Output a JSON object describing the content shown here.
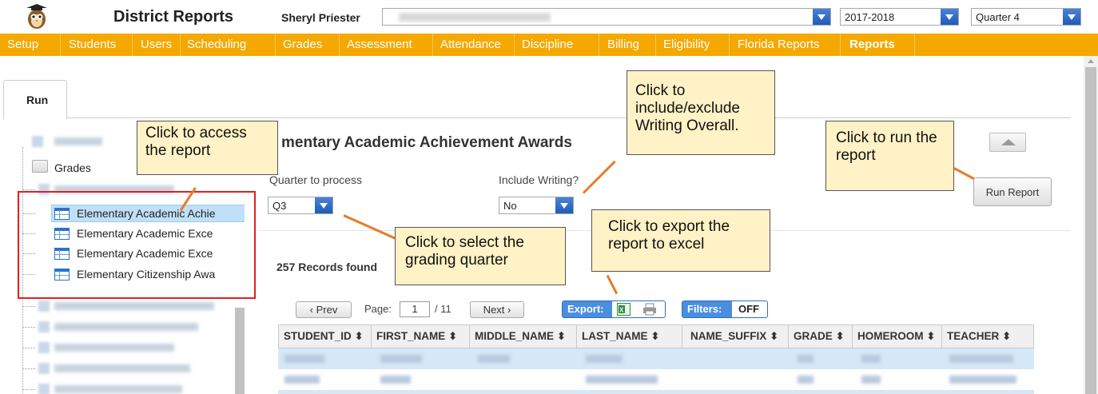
{
  "header": {
    "app_title": "District Reports",
    "user_name": "Sheryl Priester",
    "school_select": {
      "value": ""
    },
    "year_select": {
      "value": "2017-2018"
    },
    "quarter_select": {
      "value": "Quarter 4"
    }
  },
  "nav": {
    "items": [
      "Setup",
      "Students",
      "Users",
      "Scheduling",
      "Grades",
      "Assessment",
      "Attendance",
      "Discipline",
      "Billing",
      "Eligibility",
      "Florida Reports",
      "Reports"
    ],
    "active": "Reports",
    "color": "#f5a800"
  },
  "tabs": {
    "run": "Run"
  },
  "tree": {
    "grades_folder": "Grades",
    "reports": [
      "Elementary Academic Achie",
      "Elementary Academic Exce",
      "Elementary Academic Exce",
      "Elementary Citizenship Awa"
    ],
    "selected_index": 0
  },
  "report": {
    "title": "mentary Academic Achievement Awards",
    "quarter_label": "Quarter to process",
    "quarter_value": "Q3",
    "writing_label": "Include Writing?",
    "writing_value": "No",
    "run_button": "Run Report",
    "records_found": "257 Records found"
  },
  "pager": {
    "prev": "‹ Prev",
    "page_label": "Page:",
    "page_value": "1",
    "page_total": "/ 11",
    "next": "Next ›",
    "export_label": "Export:",
    "filters_label": "Filters:",
    "filters_value": "OFF"
  },
  "grid": {
    "columns": [
      "STUDENT_ID ⬍",
      "FIRST_NAME ⬍",
      "MIDDLE_NAME ⬍",
      "LAST_NAME ⬍",
      "NAME_SUFFIX ⬍",
      "GRADE ⬍",
      "HOMEROOM ⬍",
      "TEACHER ⬍"
    ]
  },
  "callouts": {
    "access": "Click to access the report",
    "writing": "Click to include/exclude Writing Overall.",
    "run": "Click to run the report",
    "quarter": "Click to select the grading quarter",
    "export": "Click to export the report to excel"
  }
}
